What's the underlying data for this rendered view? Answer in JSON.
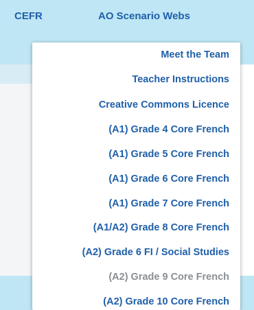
{
  "nav": {
    "items": [
      {
        "label": "CEFR"
      },
      {
        "label": "AO Scenario Webs"
      }
    ]
  },
  "dropdown": {
    "items": [
      {
        "label": "Meet the Team"
      },
      {
        "label": "Teacher Instructions"
      },
      {
        "label": "Creative Commons Licence"
      },
      {
        "label": "(A1) Grade 4 Core French"
      },
      {
        "label": "(A1) Grade 5 Core French"
      },
      {
        "label": "(A1) Grade 6 Core French"
      },
      {
        "label": "(A1) Grade 7 Core French"
      },
      {
        "label": "(A1/A2) Grade 8 Core French"
      },
      {
        "label": "(A2) Grade 6 FI / Social Studies"
      },
      {
        "label": "(A2) Grade 9 Core French"
      },
      {
        "label": "(A2) Grade 10 Core French"
      }
    ]
  },
  "colors": {
    "header_background": "#bfe6f5",
    "link_text": "#1f5fa8",
    "muted_text": "#8a8f94"
  }
}
